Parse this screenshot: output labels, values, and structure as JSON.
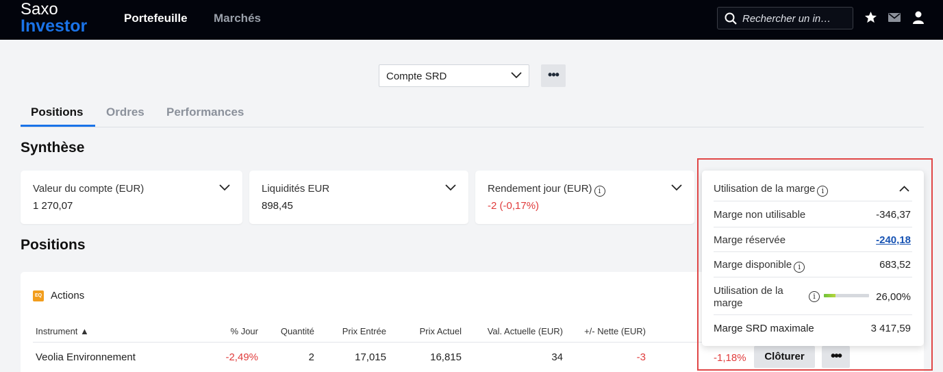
{
  "header": {
    "logo_line1": "Saxo",
    "logo_line2": "Investor",
    "nav": [
      "Portefeuille",
      "Marchés"
    ],
    "search_placeholder": "Rechercher un in…",
    "icons": [
      "search-icon",
      "star-icon",
      "mail-icon",
      "user-icon"
    ]
  },
  "account": {
    "selected": "Compte SRD",
    "more_label": "•••"
  },
  "tabs": [
    "Positions",
    "Ordres",
    "Performances"
  ],
  "summary": {
    "title": "Synthèse",
    "cards": [
      {
        "label": "Valeur du compte (EUR)",
        "value": "1 270,07"
      },
      {
        "label": "Liquidités EUR",
        "value": "898,45"
      },
      {
        "label": "Rendement jour (EUR)",
        "value": "-2 (-0,17%)"
      }
    ]
  },
  "margin": {
    "title": "Utilisation de la marge",
    "rows": [
      {
        "label": "Marge non utilisable",
        "value": "-346,37"
      },
      {
        "label": "Marge réservée",
        "value": "-240,18"
      },
      {
        "label": "Marge disponible",
        "value": "683,52"
      },
      {
        "label_line1": "Utilisation de la",
        "label_line2": "marge",
        "value": "26,00%",
        "fill_fraction": 0.26
      },
      {
        "label": "Marge SRD maximale",
        "value": "3 417,59"
      }
    ]
  },
  "positions": {
    "title": "Positions",
    "group_badge": "EQ",
    "group_label": "Actions",
    "columns": [
      "Instrument ▲",
      "% Jour",
      "Quantité",
      "Prix Entrée",
      "Prix Actuel",
      "Val. Actuelle (EUR)",
      "+/- Nette (EUR)"
    ],
    "rows": [
      {
        "instrument": "Veolia Environnement",
        "pct_day": "-2,49%",
        "quantity": "2",
        "entry_price": "17,015",
        "current_price": "16,815",
        "current_value": "34",
        "net": "-3",
        "net_pct": "-1,18%",
        "close_label": "Clôturer",
        "more_label": "•••"
      }
    ]
  },
  "colors": {
    "accent": "#1a73e8",
    "negative": "#e03b3b",
    "highlight": "#e04646",
    "topbar": "#02040c"
  }
}
